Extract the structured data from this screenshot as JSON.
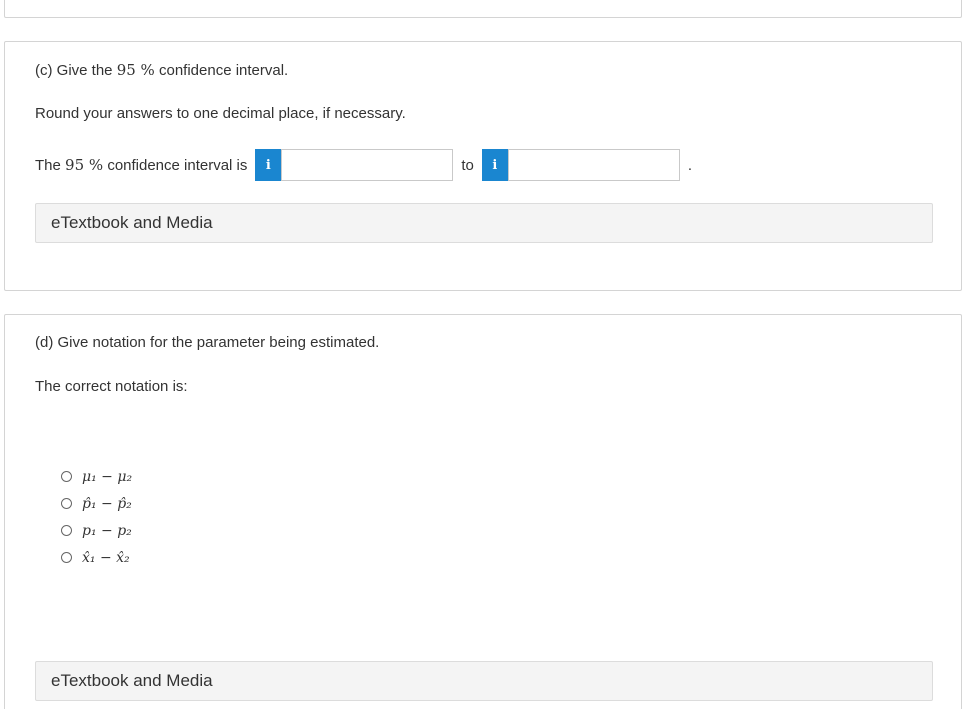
{
  "colors": {
    "accent": "#1a86d0",
    "card_border": "#d4d4d4",
    "button_bg": "#f4f4f4"
  },
  "part_c": {
    "prompt_prefix": "(c) Give the",
    "prompt_math": "95 %",
    "prompt_suffix": "confidence interval.",
    "instruction": "Round your answers to one decimal place, if necessary.",
    "ci_prefix": "The",
    "ci_math": "95 %",
    "ci_suffix": "confidence interval is",
    "info_icon_glyph": "i",
    "lower_value": "",
    "to_label": "to",
    "upper_value": "",
    "period": ".",
    "etextbook_label": "eTextbook and Media"
  },
  "part_d": {
    "prompt": "(d) Give notation for the parameter being estimated.",
    "instruction": "The correct notation is:",
    "options": [
      {
        "label": "μ₁ − μ₂"
      },
      {
        "label": "p̂₁ − p̂₂"
      },
      {
        "label": "p₁ − p₂"
      },
      {
        "label": "x̂₁ − x̂₂"
      }
    ],
    "etextbook_label": "eTextbook and Media"
  }
}
